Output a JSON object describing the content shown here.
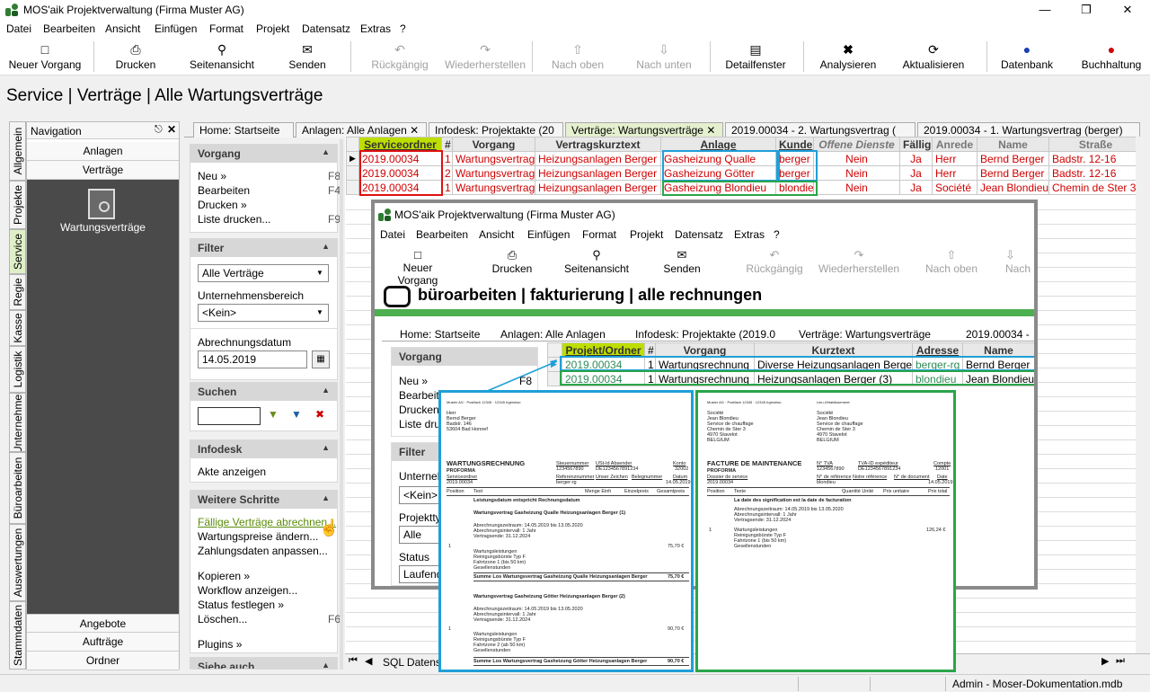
{
  "window": {
    "title": "MOS'aik Projektverwaltung (Firma Muster AG)"
  },
  "menu": [
    "Datei",
    "Bearbeiten",
    "Ansicht",
    "Einfügen",
    "Format",
    "Projekt",
    "Datensatz",
    "Extras",
    "?"
  ],
  "toolbar": {
    "new": "Neuer Vorgang",
    "print": "Drucken",
    "preview": "Seitenansicht",
    "send": "Senden",
    "undo": "Rückgängig",
    "redo": "Wiederherstellen",
    "up": "Nach oben",
    "down": "Nach unten",
    "detail": "Detailfenster",
    "analyze": "Analysieren",
    "refresh": "Aktualisieren",
    "db": "Datenbank",
    "booking": "Buchhaltung"
  },
  "heading": "Service | Verträge | Alle Wartungsverträge",
  "nav": {
    "title": "Navigation",
    "vtabs": [
      "Allgemein",
      "Projekte",
      "Service",
      "Regie",
      "Kasse",
      "Logistik",
      "Unternehmer",
      "Büroarbeiten",
      "Auswertungen",
      "Stammdaten"
    ],
    "top": [
      "Anlagen",
      "Verträge"
    ],
    "feature": "Wartungsverträge",
    "bottom": [
      "Angebote",
      "Aufträge",
      "Ordner"
    ]
  },
  "actions": {
    "vorgang": {
      "title": "Vorgang",
      "new": "Neu »",
      "newk": "F8",
      "edit": "Bearbeiten",
      "editk": "F4",
      "print": "Drucken »",
      "list": "Liste drucken...",
      "listk": "F9"
    },
    "filter": {
      "title": "Filter",
      "combo1": "Alle Verträge",
      "lbl2": "Unternehmensbereich",
      "combo2": "<Kein>",
      "lbl3": "Abrechnungsdatum",
      "date": "14.05.2019"
    },
    "search": {
      "title": "Suchen"
    },
    "infodesk": {
      "title": "Infodesk",
      "item": "Akte anzeigen"
    },
    "steps": {
      "title": "Weitere Schritte",
      "a": "Fällige Verträge abrechnen...",
      "b": "Wartungspreise ändern...",
      "c": "Zahlungsdaten anpassen...",
      "d": "Kopieren »",
      "e": "Workflow anzeigen...",
      "f": "Status festlegen »",
      "g": "Löschen...",
      "gk": "F6",
      "h": "Plugins »"
    },
    "more": {
      "title": "Siehe auch"
    }
  },
  "tabs": [
    "Home: Startseite",
    "Anlagen: Alle Anlagen",
    "Infodesk: Projektakte (20",
    "Verträge: Wartungsverträge",
    "2019.00034 - 2. Wartungsvertrag (",
    "2019.00034 - 1. Wartungsvertrag (berger)"
  ],
  "grid": {
    "headers": [
      "Serviceordner",
      "#",
      "Vorgang",
      "Vertragskurztext",
      "Anlage",
      "Kunde",
      "Offene Dienste",
      "Fällig",
      "Anrede",
      "Name",
      "Straße"
    ],
    "rows": [
      [
        "2019.00034",
        "1",
        "Wartungsvertrag",
        "Heizungsanlagen Berger",
        "Gasheizung Qualle",
        "berger",
        "Nein",
        "Ja",
        "Herr",
        "Bernd Berger",
        "Badstr. 12-16"
      ],
      [
        "2019.00034",
        "2",
        "Wartungsvertrag",
        "Heizungsanlagen Berger",
        "Gasheizung Götter",
        "berger",
        "Nein",
        "Ja",
        "Herr",
        "Bernd Berger",
        "Badstr. 12-16"
      ],
      [
        "2019.00034",
        "1",
        "Wartungsvertrag",
        "Heizungsanlagen Berger",
        "Gasheizung Blondieu",
        "blondie",
        "Nein",
        "Ja",
        "Société",
        "Jean Blondieu",
        "Chemin de Ster 3"
      ]
    ],
    "footer": "SQL Datensa"
  },
  "overlay": {
    "title": "MOS'aik Projektverwaltung (Firma Muster AG)",
    "menu": [
      "Datei",
      "Bearbeiten",
      "Ansicht",
      "Einfügen",
      "Format",
      "Projekt",
      "Datensatz",
      "Extras",
      "?"
    ],
    "toolbar": [
      "Neuer Vorgang",
      "Drucken",
      "Seitenansicht",
      "Senden",
      "Rückgängig",
      "Wiederherstellen",
      "Nach oben",
      "Nach"
    ],
    "heading": "büroarbeiten | fakturierung | alle rechnungen",
    "tabs": [
      "Home: Startseite",
      "Anlagen: Alle Anlagen",
      "Infodesk: Projektakte (2019.0",
      "Verträge: Wartungsverträge",
      "2019.00034 -"
    ],
    "vorgang": "Vorgang",
    "neu": "Neu »",
    "neuk": "F8",
    "bearbeiten": "Bearbeite",
    "drucken": "Drucken »",
    "liste": "Liste druc",
    "filter": "Filter",
    "unt": "Unternehm",
    "kein": "<Kein>",
    "ptyp": "Projekttyp",
    "alle": "Alle",
    "status": "Status",
    "laufend": "Laufende",
    "headers": [
      "Projekt/Ordner",
      "#",
      "Vorgang",
      "Kurztext",
      "Adresse",
      "Name"
    ],
    "rows": [
      [
        "2019.00034",
        "1",
        "Wartungsrechnung",
        "Diverse Heizungsanlagen Berger",
        "berger-rg",
        "Bernd Berger"
      ],
      [
        "2019.00034",
        "1",
        "Wartungsrechnung",
        "Heizungsanlagen Berger (3)",
        "blondieu",
        "Jean Blondieu"
      ]
    ]
  },
  "doc1": {
    "sender": "Muster AG · Postfach 12345 · 12345 Irgendwo",
    "to1": "Herr",
    "to2": "Bernd Berger",
    "to3": "Badstr. 146",
    "to4": "53604 Bad Honnef",
    "title": "WARTUNGSRECHNUNG",
    "sub": "PROFORMA",
    "h1": "Steuernummer",
    "h2": "USt-Id Absender",
    "h3": "Konto",
    "v1": "1234567890",
    "v2": "DE1234567891234",
    "v3": "32002",
    "r1": "Serviceordner",
    "r2": "Referenznummer",
    "r3": "Unser Zeichen",
    "r4": "Belegnummer",
    "r5": "Datum",
    "rv1": "2019.00034",
    "rv2": "berger-rg",
    "rv5": "14.05.2019",
    "c1": "Position",
    "c2": "Text",
    "c3": "Menge Einh",
    "c4": "Einzelpreis",
    "c5": "Gesamtpreis",
    "l1": "Leistungsdatum entspricht Rechnungsdatum",
    "l2": "Wartungsvertrag Gasheizung Qualle Heizungsanlagen Berger (1)",
    "l3": "Abrechnungszeitraum: 14.05.2019 bis 13.05.2020",
    "l4": "Abrechnungsintervall: 1 Jahr",
    "l5": "Vertragsende: 31.12.2024",
    "p1": "1",
    "l6": "Wartungsleistungen",
    "l7": "Reinigungsbürste Typ F",
    "l8": "Fahrtzone 1 (bis 50 km)",
    "l9": "Gesellenstunden",
    "price1": "75,70 €",
    "s1": "Summe Los Wartungsvertrag Gasheizung Qualle Heizungsanlagen Berger",
    "sp1": "75,70 €",
    "l10": "Wartungsvertrag Gasheizung Götter Heizungsanlagen Berger (2)",
    "l11": "Abrechnungszeitraum: 14.05.2019 bis 13.05.2020",
    "l12": "Abrechnungsintervall: 1 Jahr",
    "l13": "Vertragsende: 31.12.2024",
    "p2": "1",
    "l14": "Wartungsleistungen",
    "l15": "Reinigungsbürste Typ F",
    "l16": "Fahrtzone 2 (ab 50 km)",
    "l17": "Gesellenstunden",
    "price2": "90,70 €",
    "s2": "Summe Los Wartungsvertrag Gasheizung Götter Heizungsanlagen Berger",
    "sp2": "90,70 €"
  },
  "doc2": {
    "sender": "Muster AG · Postfach 12345 · 12345 Irgendwo",
    "lieu": "Lieu d'établissement:",
    "a1": "Société",
    "a2": "Jean Blondieu",
    "a3": "Service de chauffage",
    "a4": "Chemin de Ster 3",
    "a5": "4970 Stavelot",
    "a6": "BELGIUM",
    "title": "FACTURE DE MAINTENANCE",
    "sub": "PROFORMA",
    "h1": "N° TVA",
    "h2": "TVA-ID expéditeur",
    "h3": "Compte",
    "v1": "1234567890",
    "v2": "DE1234567891234",
    "v3": "12001",
    "r1": "Dossier de service",
    "r2": "N° de référence",
    "r3": "Notre référence",
    "r4": "N° de document",
    "r5": "Date",
    "rv1": "2019.00034",
    "rv2": "blondieu",
    "rv5": "14.05.2019",
    "c1": "Position",
    "c2": "Texte",
    "c3": "Quantité Unité",
    "c4": "Prix unitaire",
    "c5": "Prix total",
    "l1": "La date des signification est la date de facturation",
    "l2": "Abrechnungszeitraum: 14.05.2019 bis 13.05.2020",
    "l3": "Abrechnungsintervall: 1 Jahr",
    "l4": "Vertragsende: 31.12.2024",
    "p1": "1",
    "l5": "Wartungsleistungen",
    "l6": "Reinigungsbürste Typ F",
    "l7": "Fahrtzone 1 (bis 50 km)",
    "l8": "Gesellenstunden",
    "price1": "126,24 €"
  },
  "status": {
    "db": "Admin - Moser-Dokumentation.mdb"
  },
  "colors": {
    "accent_green": "#bede00",
    "blue": "#1f9fd8",
    "green": "#2aa54a",
    "red": "#e01010"
  }
}
